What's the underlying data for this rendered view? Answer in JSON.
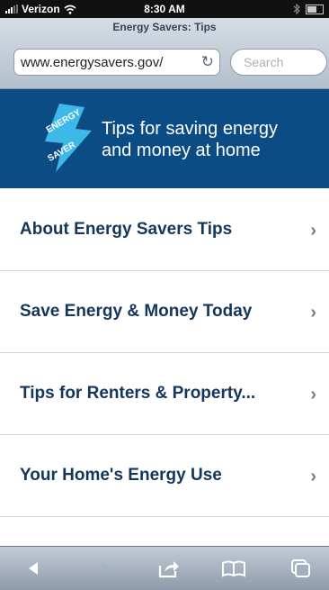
{
  "status_bar": {
    "carrier": "Verizon",
    "time": "8:30 AM",
    "icons": [
      "signal-icon",
      "wifi-icon",
      "bluetooth-icon",
      "battery-icon"
    ]
  },
  "browser": {
    "page_title": "Energy Savers: Tips",
    "url": "www.energysavers.gov/",
    "search_placeholder": "Search"
  },
  "banner": {
    "logo_text_top": "ENERGY",
    "logo_text_bottom": "SAVER",
    "line1": "Tips for saving energy",
    "line2": "and money at home",
    "color": "#0c4c84"
  },
  "menu": {
    "items": [
      {
        "label": "About Energy Savers Tips"
      },
      {
        "label": "Save Energy & Money Today"
      },
      {
        "label": "Tips for Renters & Property..."
      },
      {
        "label": "Your Home's Energy Use"
      }
    ]
  },
  "toolbar": {
    "icons": [
      "back-icon",
      "forward-icon",
      "share-icon",
      "bookmarks-icon",
      "tabs-icon"
    ]
  }
}
